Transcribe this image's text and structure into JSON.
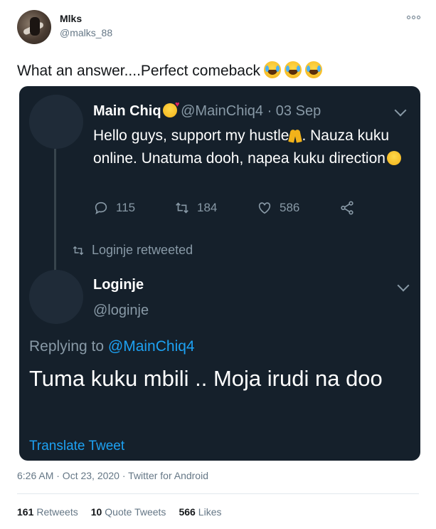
{
  "author": {
    "name": "Mlks",
    "handle": "@malks_88"
  },
  "tweet": {
    "text": "What an answer....Perfect comeback",
    "emoji": "face-with-tears-of-joy-icon"
  },
  "quoted": {
    "original": {
      "name": "Main Chiq",
      "handle": "@MainChiq4",
      "date_sep": " · 03 Sep",
      "text_part1": "Hello guys, support my hustle",
      "text_part2": ". Nauza kuku online. Unatuma dooh, napea kuku direction",
      "replies": "115",
      "retweets": "184",
      "likes": "586"
    },
    "retweeted_by": "Loginje retweeted",
    "reply": {
      "name": "Loginje",
      "handle": "@loginje",
      "replying_prefix": "Replying to ",
      "replying_to": "@MainChiq4",
      "text": "Tuma kuku mbili .. Moja irudi na doo",
      "translate": "Translate Tweet"
    }
  },
  "meta": {
    "timestamp": "6:26 AM · Oct 23, 2020 · Twitter for Android"
  },
  "stats": {
    "retweets_count": "161",
    "retweets_label": "Retweets",
    "quotes_count": "10",
    "quotes_label": "Quote Tweets",
    "likes_count": "566",
    "likes_label": "Likes"
  },
  "colors": {
    "dark_bg": "#15202b",
    "link": "#1da1f2",
    "muted": "#8899a6"
  }
}
